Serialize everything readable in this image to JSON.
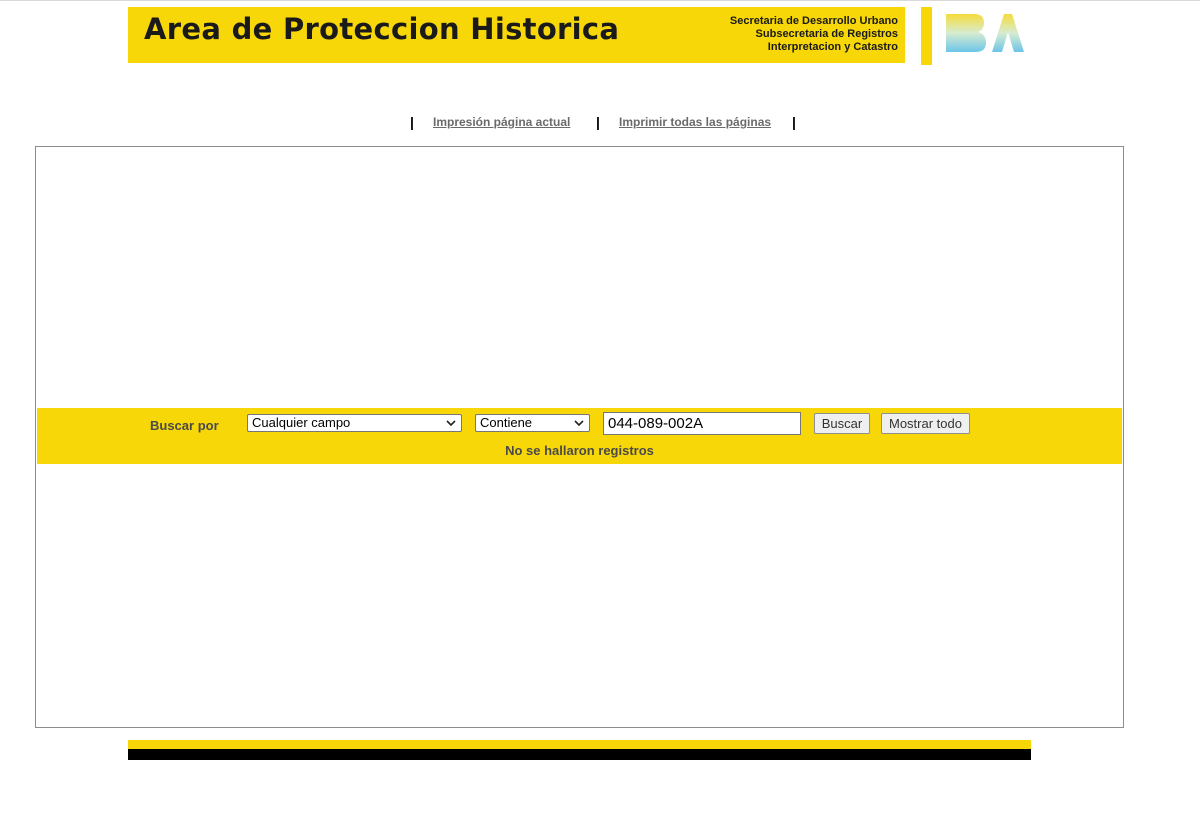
{
  "header": {
    "title": "Area de Proteccion Historica",
    "subtitle_lines": [
      "Secretaria de Desarrollo Urbano",
      "Subsecretaria de Registros",
      "Interpretacion y Catastro"
    ],
    "logo": "BA"
  },
  "print_links": {
    "separator": "|",
    "current_page": "Impresión página actual",
    "all_pages": "Imprimir todas las páginas"
  },
  "search": {
    "label": "Buscar por",
    "field_select": "Cualquier campo",
    "operator_select": "Contiene",
    "query_value": "044-089-002A",
    "search_button": "Buscar",
    "show_all_button": "Mostrar todo",
    "result_message": "No se hallaron registros"
  },
  "colors": {
    "accent_yellow": "#f7d708",
    "footer_black": "#000000"
  }
}
